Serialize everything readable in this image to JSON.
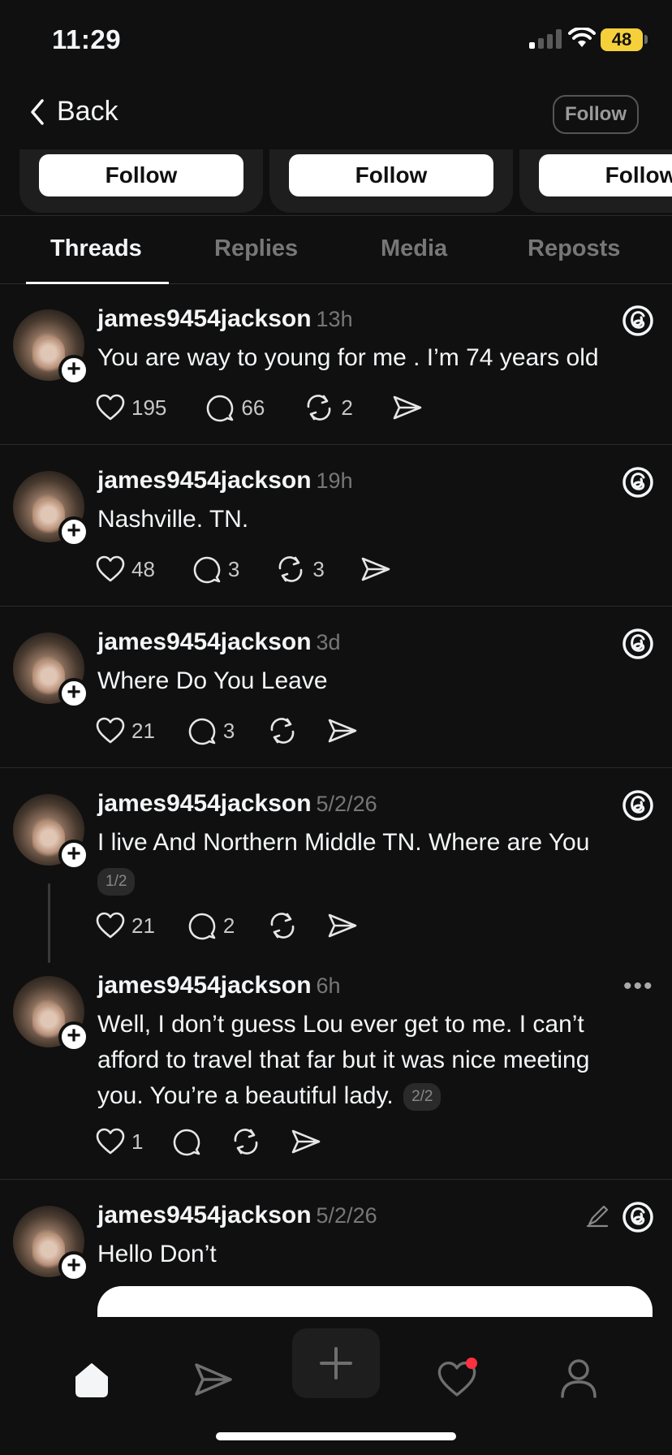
{
  "status_bar": {
    "time": "11:29",
    "battery": "48"
  },
  "header": {
    "back_label": "Back",
    "follow_label": "Follow"
  },
  "suggestion_cards": [
    {
      "button_label": "Follow"
    },
    {
      "button_label": "Follow"
    },
    {
      "button_label": "Follow"
    }
  ],
  "tabs": [
    {
      "label": "Threads",
      "active": true
    },
    {
      "label": "Replies",
      "active": false
    },
    {
      "label": "Media",
      "active": false
    },
    {
      "label": "Reposts",
      "active": false
    }
  ],
  "posts": [
    {
      "username": "james9454jackson",
      "time": "13h",
      "text": "You  are way to  young for me . I’m 74 years old",
      "likes": "195",
      "replies": "66",
      "reposts": "2"
    },
    {
      "username": "james9454jackson",
      "time": "19h",
      "text": "Nashville. TN.",
      "likes": "48",
      "replies": "3",
      "reposts": "3"
    },
    {
      "username": "james9454jackson",
      "time": "3d",
      "text": "Where Do You Leave",
      "likes": "21",
      "replies": "3",
      "reposts": ""
    },
    {
      "username": "james9454jackson",
      "time": "5/2/26",
      "text": "I live And Northern Middle TN. Where are You",
      "part": "1/2",
      "likes": "21",
      "replies": "2",
      "reposts": ""
    },
    {
      "username": "james9454jackson",
      "time": "6h",
      "text": "Well, I don’t guess Lou ever get to me. I can’t afford to travel that far but it was nice meeting you. You’re a beautiful lady.",
      "part": "2/2",
      "likes": "1",
      "replies": "",
      "reposts": ""
    },
    {
      "username": "james9454jackson",
      "time": "5/2/26",
      "text": "Hello  Don’t"
    }
  ],
  "icons": {
    "back": "chevron-left-icon",
    "like": "heart-icon",
    "reply": "comment-icon",
    "repost": "repost-icon",
    "share": "send-icon",
    "threads": "threads-logo-icon",
    "more": "more-icon",
    "edit": "edit-icon",
    "nav": [
      "home-icon",
      "send-icon",
      "plus-icon",
      "heart-icon",
      "profile-icon"
    ]
  },
  "colors": {
    "background": "#101010",
    "battery": "#f5d03b",
    "notification_dot": "#ff3040"
  }
}
